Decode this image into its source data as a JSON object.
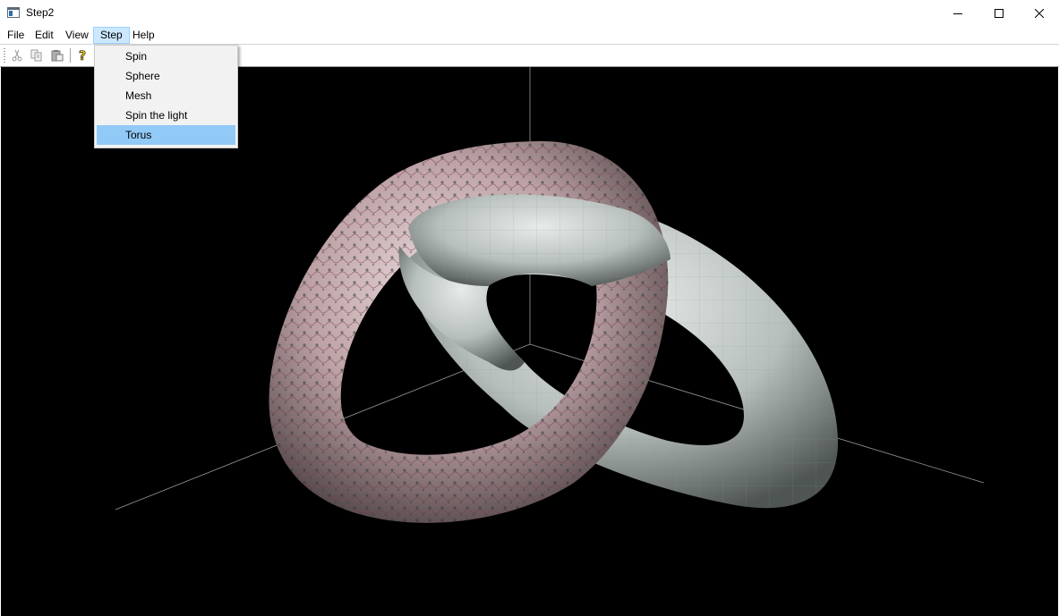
{
  "window": {
    "title": "Step2"
  },
  "menubar": {
    "items": [
      {
        "label": "File"
      },
      {
        "label": "Edit"
      },
      {
        "label": "View"
      },
      {
        "label": "Step"
      },
      {
        "label": "Help"
      }
    ]
  },
  "step_menu": {
    "items": [
      {
        "label": "Spin"
      },
      {
        "label": "Sphere"
      },
      {
        "label": "Mesh"
      },
      {
        "label": "Spin the light"
      },
      {
        "label": "Torus"
      }
    ],
    "highlighted": "Torus"
  },
  "toolbar": {
    "buttons": [
      "cut-icon",
      "copy-icon",
      "paste-icon",
      "help-icon"
    ]
  },
  "colors": {
    "highlight": "#91c9f7",
    "menu_open": "#cce8ff",
    "viewport_bg": "#000000"
  }
}
